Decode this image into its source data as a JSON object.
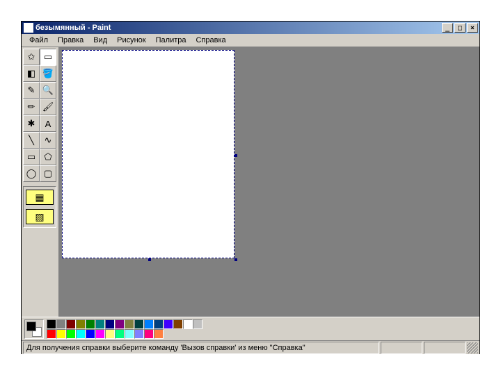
{
  "title": "безымянный - Paint",
  "menubar": [
    "Файл",
    "Правка",
    "Вид",
    "Рисунок",
    "Палитра",
    "Справка"
  ],
  "tools": [
    {
      "name": "free-select-tool",
      "glyph": "✩"
    },
    {
      "name": "rect-select-tool",
      "glyph": "▭"
    },
    {
      "name": "eraser-tool",
      "glyph": "◧"
    },
    {
      "name": "fill-tool",
      "glyph": "🪣"
    },
    {
      "name": "picker-tool",
      "glyph": "✎"
    },
    {
      "name": "magnifier-tool",
      "glyph": "🔍"
    },
    {
      "name": "pencil-tool",
      "glyph": "✏"
    },
    {
      "name": "brush-tool",
      "glyph": "🖌"
    },
    {
      "name": "airbrush-tool",
      "glyph": "✱"
    },
    {
      "name": "text-tool",
      "glyph": "A"
    },
    {
      "name": "line-tool",
      "glyph": "╲"
    },
    {
      "name": "curve-tool",
      "glyph": "∿"
    },
    {
      "name": "rectangle-tool",
      "glyph": "▭"
    },
    {
      "name": "polygon-tool",
      "glyph": "⬠"
    },
    {
      "name": "ellipse-tool",
      "glyph": "◯"
    },
    {
      "name": "rounded-rect-tool",
      "glyph": "▢"
    }
  ],
  "palette_row1": [
    "#000000",
    "#808080",
    "#800000",
    "#808000",
    "#008000",
    "#008080",
    "#000080",
    "#800080",
    "#808040",
    "#004040",
    "#0080ff",
    "#004080",
    "#4000ff",
    "#804000"
  ],
  "palette_row2": [
    "#ffffff",
    "#c0c0c0",
    "#ff0000",
    "#ffff00",
    "#00ff00",
    "#00ffff",
    "#0000ff",
    "#ff00ff",
    "#ffff80",
    "#00ff80",
    "#80ffff",
    "#8080ff",
    "#ff0080",
    "#ff8040"
  ],
  "colors": {
    "fg": "#000000",
    "bg": "#ffffff"
  },
  "status": "Для получения справки выберите команду 'Вызов справки' из меню \"Справка\"",
  "winbtns": {
    "min": "_",
    "max": "□",
    "close": "×"
  }
}
